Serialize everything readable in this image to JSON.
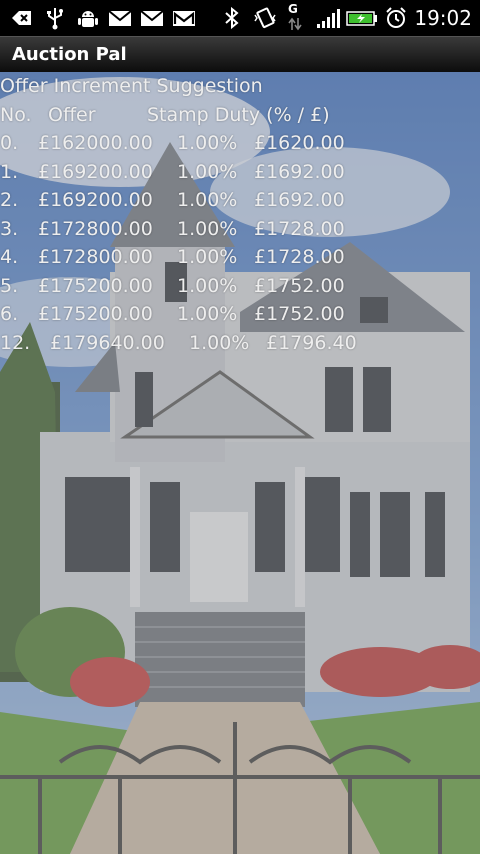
{
  "status_bar": {
    "time": "19:02",
    "signal_type": "G",
    "icons": [
      "back-icon",
      "usb-icon",
      "android-debug-icon",
      "mail-icon",
      "mail-icon",
      "gmail-icon",
      "bluetooth-icon",
      "vibrate-icon",
      "data-arrows-icon",
      "signal-icon",
      "battery-icon",
      "alarm-icon"
    ]
  },
  "app": {
    "title": "Auction Pal"
  },
  "main": {
    "heading": "Offer Increment Suggestion",
    "columns": {
      "no": "No.",
      "offer": "Offer",
      "stamp_duty": "Stamp Duty (% / £)"
    },
    "rows": [
      {
        "no": "0.",
        "offer": "£162000.00",
        "percent": "1.00%",
        "duty": "£1620.00"
      },
      {
        "no": "1.",
        "offer": "£169200.00",
        "percent": "1.00%",
        "duty": "£1692.00"
      },
      {
        "no": "2.",
        "offer": "£169200.00",
        "percent": "1.00%",
        "duty": "£1692.00"
      },
      {
        "no": "3.",
        "offer": "£172800.00",
        "percent": "1.00%",
        "duty": "£1728.00"
      },
      {
        "no": "4.",
        "offer": "£172800.00",
        "percent": "1.00%",
        "duty": "£1728.00"
      },
      {
        "no": "5.",
        "offer": "£175200.00",
        "percent": "1.00%",
        "duty": "£1752.00"
      },
      {
        "no": "6.",
        "offer": "£175200.00",
        "percent": "1.00%",
        "duty": "£1752.00"
      },
      {
        "no": "12.",
        "offer": "£179640.00",
        "percent": "1.00%",
        "duty": "£1796.40"
      }
    ]
  },
  "colors": {
    "text": "#eeeeee",
    "sky": "#4f7fc4",
    "house": "#c9cdd4",
    "lawn": "#5f9a3a"
  }
}
